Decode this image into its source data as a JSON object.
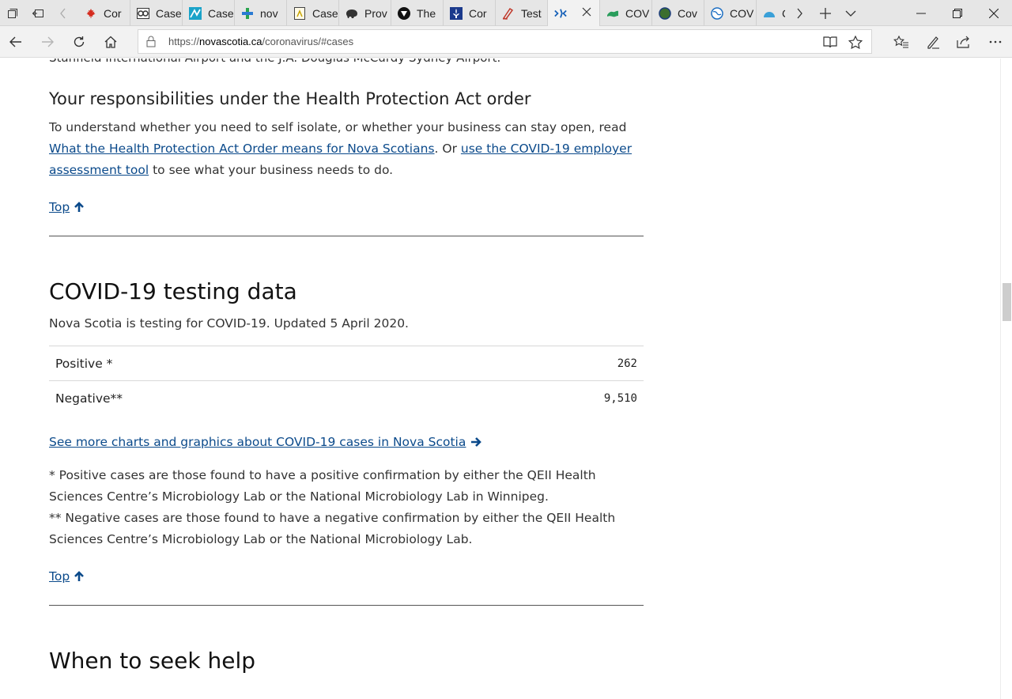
{
  "tabs": [
    {
      "title": "Cor",
      "icon": "maple-leaf-icon"
    },
    {
      "title": "Case",
      "icon": "cbc-icon"
    },
    {
      "title": "Case",
      "icon": "chart-icon"
    },
    {
      "title": "nov",
      "icon": "cross-icon"
    },
    {
      "title": "Case",
      "icon": "document-icon"
    },
    {
      "title": "Prov",
      "icon": "bison-icon"
    },
    {
      "title": "The",
      "icon": "shield-icon"
    },
    {
      "title": "Cor",
      "icon": "fleur-de-lis-icon"
    },
    {
      "title": "Test",
      "icon": "pen-icon"
    },
    {
      "title": "",
      "icon": "nova-scotia-icon",
      "active": true
    },
    {
      "title": "COV",
      "icon": "map-icon"
    },
    {
      "title": "Cov",
      "icon": "globe-icon"
    },
    {
      "title": "COV",
      "icon": "world-icon"
    },
    {
      "title": "C",
      "icon": "dome-icon"
    }
  ],
  "address_bar": {
    "url_prefix": "https://",
    "url_host": "novascotia.ca",
    "url_path": "/coronavirus/#cases"
  },
  "page": {
    "cut_line": "Stanfield International Airport and the J.A. Douglas McCurdy Sydney Airport.",
    "responsibilities": {
      "heading": "Your responsibilities under the Health Protection Act order",
      "text_1": "To understand whether you need to self isolate, or whether your business can stay open, read ",
      "link_1": "What the Health Protection Act Order means for Nova Scotians",
      "text_2": ". Or ",
      "link_2": "use the COVID-19 employer assessment tool",
      "text_3": " to see what your business needs to do."
    },
    "top_label": "Top",
    "testing": {
      "heading": "COVID-19 testing data",
      "updated": "Nova Scotia is testing for COVID-19. Updated 5 April 2020.",
      "rows": [
        {
          "label": "Positive *",
          "value": "262"
        },
        {
          "label": "Negative**",
          "value": "9,510"
        }
      ],
      "more_link": "See more charts and graphics about COVID-19 cases in Nova Scotia",
      "note_positive": "* Positive cases are those found to have a positive confirmation by either the QEII Health Sciences Centre’s Microbiology Lab or the National Microbiology Lab in Winnipeg.",
      "note_negative": "** Negative cases are those found to have a negative confirmation by either the QEII Health Sciences Centre’s Microbiology Lab or the National Microbiology Lab."
    },
    "next_heading": "When to seek help"
  },
  "colors": {
    "link": "#0b4a8b",
    "tabbar": "#e6e6e6",
    "rule": "#555555"
  }
}
